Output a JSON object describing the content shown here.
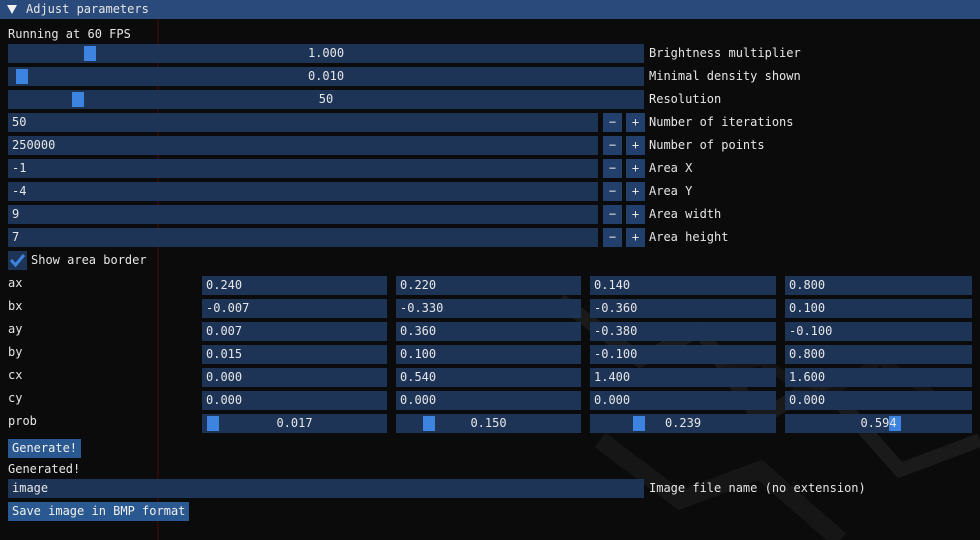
{
  "window": {
    "title": "Adjust parameters"
  },
  "status": {
    "fps_text": "Running at 60 FPS",
    "generated_text": "Generated!"
  },
  "sliders": [
    {
      "label": "Brightness multiplier",
      "value": "1.000",
      "position": 0.12
    },
    {
      "label": "Minimal density shown",
      "value": "0.010",
      "position": 0.01
    },
    {
      "label": "Resolution",
      "value": "50",
      "position": 0.1
    }
  ],
  "steppers": [
    {
      "label": "Number of iterations",
      "value": "50"
    },
    {
      "label": "Number of points",
      "value": "250000"
    },
    {
      "label": "Area X",
      "value": "-1"
    },
    {
      "label": "Area Y",
      "value": "-4"
    },
    {
      "label": "Area width",
      "value": "9"
    },
    {
      "label": "Area height",
      "value": "7"
    }
  ],
  "stepper_buttons": {
    "minus": "−",
    "plus": "+"
  },
  "checkbox": {
    "label": "Show area border",
    "checked": true
  },
  "matrix": {
    "rows": [
      {
        "label": "ax",
        "values": [
          "0.240",
          "0.220",
          "0.140",
          "0.800"
        ]
      },
      {
        "label": "bx",
        "values": [
          "-0.007",
          "-0.330",
          "-0.360",
          "0.100"
        ]
      },
      {
        "label": "ay",
        "values": [
          "0.007",
          "0.360",
          "-0.380",
          "-0.100"
        ]
      },
      {
        "label": "by",
        "values": [
          "0.015",
          "0.100",
          "-0.100",
          "0.800"
        ]
      },
      {
        "label": "cx",
        "values": [
          "0.000",
          "0.540",
          "1.400",
          "1.600"
        ]
      },
      {
        "label": "cy",
        "values": [
          "0.000",
          "0.000",
          "0.000",
          "0.000"
        ]
      }
    ],
    "prob": {
      "label": "prob",
      "values": [
        "0.017",
        "0.150",
        "0.239",
        "0.594"
      ],
      "positions": [
        0.017,
        0.15,
        0.239,
        0.594
      ]
    }
  },
  "generate_button": "Generate!",
  "filename": {
    "value": "image",
    "label": "Image file name (no extension)"
  },
  "save_button": "Save image in BMP format",
  "colors": {
    "title_bar": "#294a7a",
    "field": "#1d3457",
    "grab": "#3d83e0",
    "button": "#2a5891",
    "background": "#0b0b0b"
  }
}
